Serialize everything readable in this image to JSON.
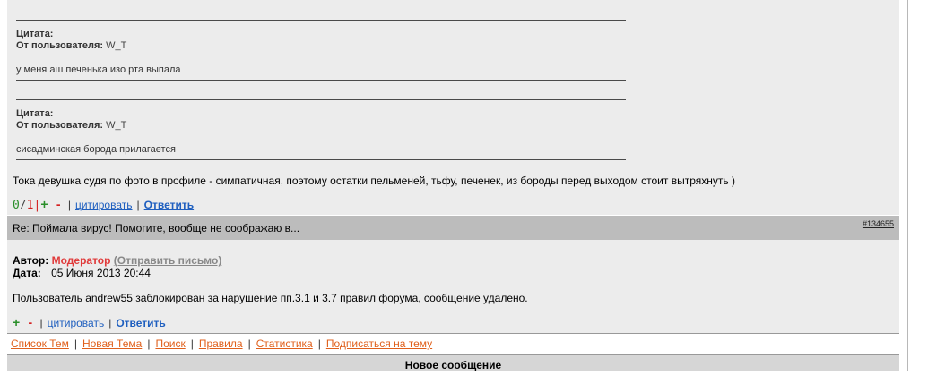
{
  "quotes": [
    {
      "label": "Цитата:",
      "from_label": "От пользователя:",
      "user": "W_T",
      "text": "у меня аш печенька изо рта выпала"
    },
    {
      "label": "Цитата:",
      "from_label": "От пользователя:",
      "user": "W_T",
      "text": "сисадминская борода прилагается"
    }
  ],
  "post1": {
    "text": "Тока девушка судя по фото в профиле - симпатичная, поэтому остатки пельменей, тьфу, печенек, из бороды перед выходом стоит вытряхнуть )",
    "rating": {
      "up": "0",
      "slash": "/",
      "down": "1",
      "bar": "|"
    },
    "plus": "+",
    "minus": "-",
    "quote_link": "цитировать",
    "reply_link": "Ответить"
  },
  "post2_header": {
    "title": "Re: Поймала вирус! Помогите, вообще не соображаю в...",
    "number": "#134655"
  },
  "post2": {
    "author_label": "Автор:",
    "author": "Модератор",
    "mail_link": "(Отправить письмо)",
    "date_label": "Дата:",
    "date": "05 Июня 2013 20:44",
    "text": "Пользователь andrew55 заблокирован за нарушение пп.3.1 и 3.7 правил форума, сообщение удалено.",
    "plus": "+",
    "minus": "-",
    "quote_link": "цитировать",
    "reply_link": "Ответить"
  },
  "nav": {
    "items": [
      "Список Тем",
      "Новая Тема",
      "Поиск",
      "Правила",
      "Статистика",
      "Подписаться на тему"
    ]
  },
  "new_message": {
    "title": "Новое сообщение"
  },
  "colors": {
    "link_blue": "#1f5fbf",
    "nav_orange": "#e0601c",
    "moderator_red": "#e03a3a",
    "plus_green": "#2a8f2a",
    "minus_red": "#d42020"
  }
}
